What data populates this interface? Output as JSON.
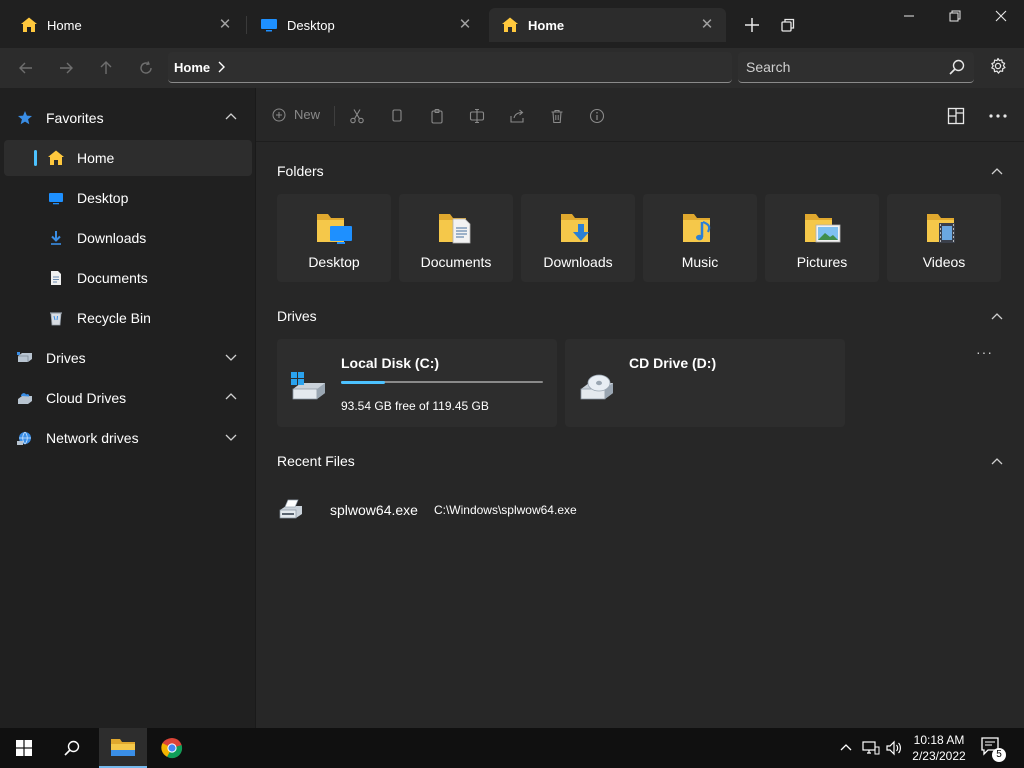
{
  "tabs": [
    {
      "label": "Home",
      "icon": "home-icon",
      "active": false
    },
    {
      "label": "Desktop",
      "icon": "desktop-icon",
      "active": false
    },
    {
      "label": "Home",
      "icon": "home-icon",
      "active": true
    }
  ],
  "address": {
    "crumb": "Home"
  },
  "search": {
    "placeholder": "Search"
  },
  "sidebar": {
    "items": [
      {
        "label": "Favorites",
        "icon": "star-icon"
      },
      {
        "label": "Home",
        "icon": "home-icon"
      },
      {
        "label": "Desktop",
        "icon": "desktop-icon"
      },
      {
        "label": "Downloads",
        "icon": "download-icon"
      },
      {
        "label": "Documents",
        "icon": "document-icon"
      },
      {
        "label": "Recycle Bin",
        "icon": "recycle-bin-icon"
      },
      {
        "label": "Drives",
        "icon": "drive-icon"
      },
      {
        "label": "Cloud Drives",
        "icon": "cloud-icon"
      },
      {
        "label": "Network drives",
        "icon": "network-icon"
      }
    ]
  },
  "toolbar": {
    "new_label": "New"
  },
  "sections": {
    "folders": "Folders",
    "drives": "Drives",
    "recent": "Recent Files"
  },
  "folders": [
    {
      "label": "Desktop",
      "icon": "folder-desktop-icon"
    },
    {
      "label": "Documents",
      "icon": "folder-documents-icon"
    },
    {
      "label": "Downloads",
      "icon": "folder-downloads-icon"
    },
    {
      "label": "Music",
      "icon": "folder-music-icon"
    },
    {
      "label": "Pictures",
      "icon": "folder-pictures-icon"
    },
    {
      "label": "Videos",
      "icon": "folder-videos-icon"
    }
  ],
  "drives": [
    {
      "name": "Local Disk (C:)",
      "free": "93.54 GB free of 119.45 GB",
      "used_fraction": 0.22
    },
    {
      "name": "CD Drive (D:)"
    }
  ],
  "recent_files": [
    {
      "name": "splwow64.exe",
      "path": "C:\\Windows\\splwow64.exe"
    }
  ],
  "taskbar": {
    "time": "10:18 AM",
    "date": "2/23/2022",
    "notification_count": "5"
  },
  "colors": {
    "accent": "#4cc2ff",
    "folder_yellow": "#f5c84a",
    "home_yellow": "#ffc83d"
  }
}
